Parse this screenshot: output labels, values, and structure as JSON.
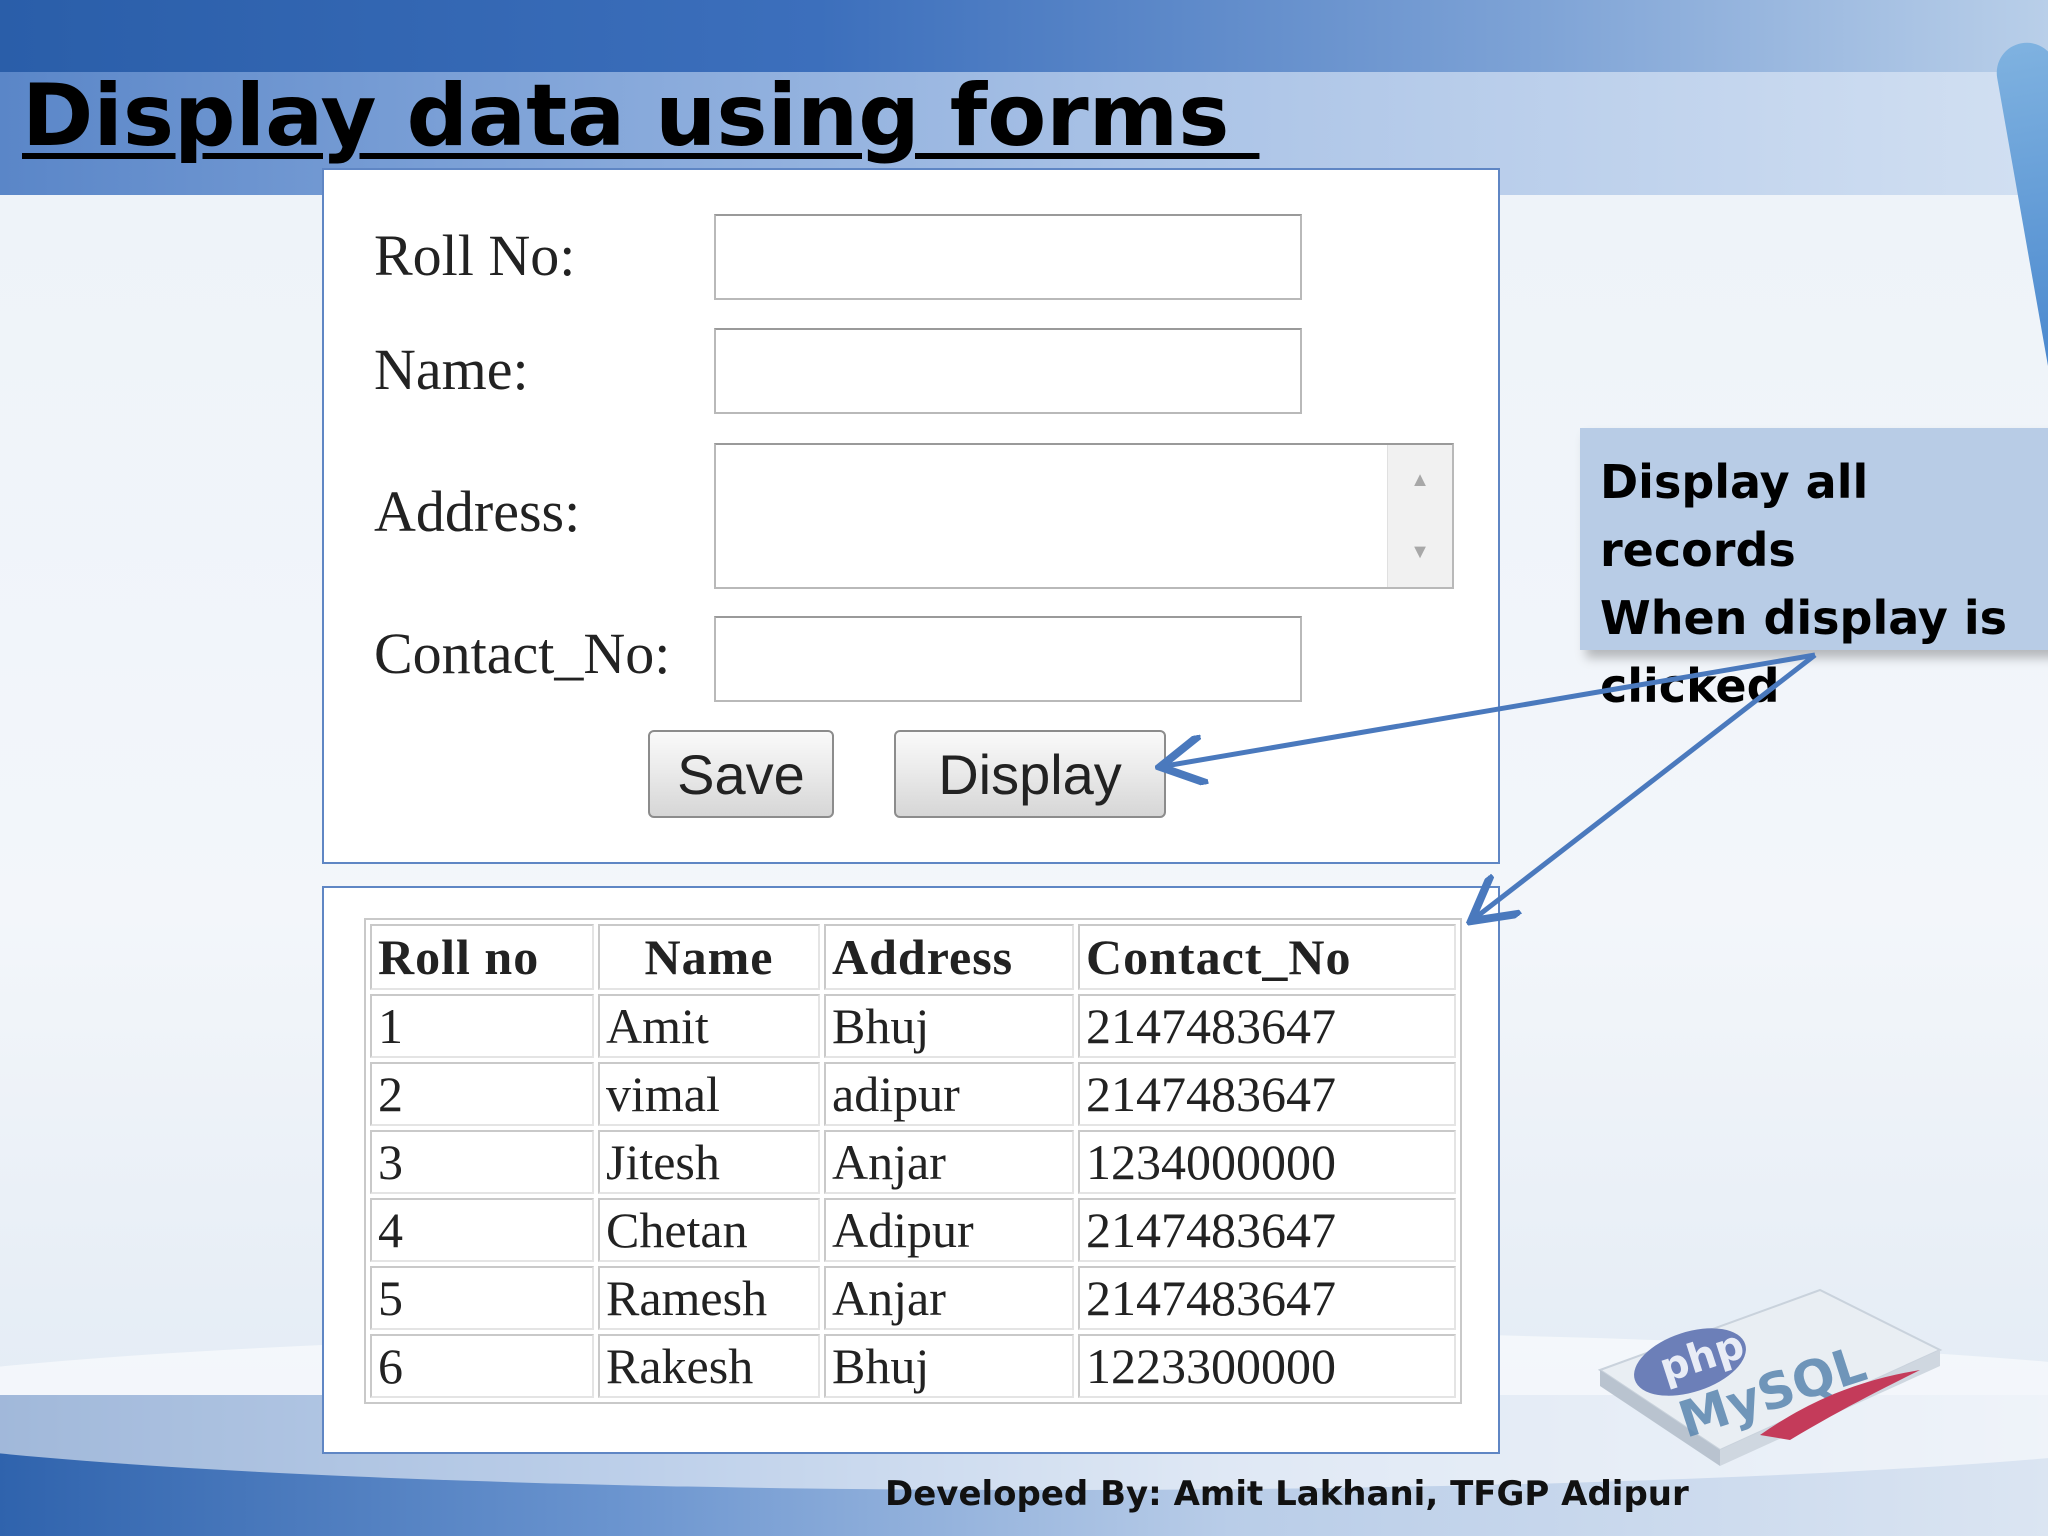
{
  "slide": {
    "title": "Display data using forms ",
    "footer": "Developed By: Amit Lakhani, TFGP Adipur"
  },
  "form": {
    "roll_label": "Roll No:",
    "roll_value": "",
    "name_label": "Name:",
    "name_value": "",
    "address_label": "Address:",
    "address_value": "",
    "contact_label": "Contact_No:",
    "contact_value": "",
    "save_label": "Save",
    "display_label": "Display"
  },
  "callout": {
    "lines": [
      "Display all records",
      "When display is",
      "clicked"
    ]
  },
  "table": {
    "headers": [
      "Roll no",
      "Name",
      "Address",
      "Contact_No"
    ],
    "rows": [
      [
        "1",
        "Amit",
        "Bhuj",
        "2147483647"
      ],
      [
        "2",
        "vimal",
        "adipur",
        "2147483647"
      ],
      [
        "3",
        "Jitesh",
        "Anjar",
        "1234000000"
      ],
      [
        "4",
        "Chetan",
        "Adipur",
        "2147483647"
      ],
      [
        "5",
        "Ramesh",
        "Anjar",
        "2147483647"
      ],
      [
        "6",
        "Rakesh",
        "Bhuj",
        "1223300000"
      ]
    ]
  },
  "logo": {
    "text_php": "php",
    "text_mysql": "MySQL",
    "icon": "php-mysql-logo-icon"
  },
  "colors": {
    "panel_border": "#5f86c4",
    "callout_bg": "#b8cce6",
    "arrow": "#4a79bd"
  }
}
